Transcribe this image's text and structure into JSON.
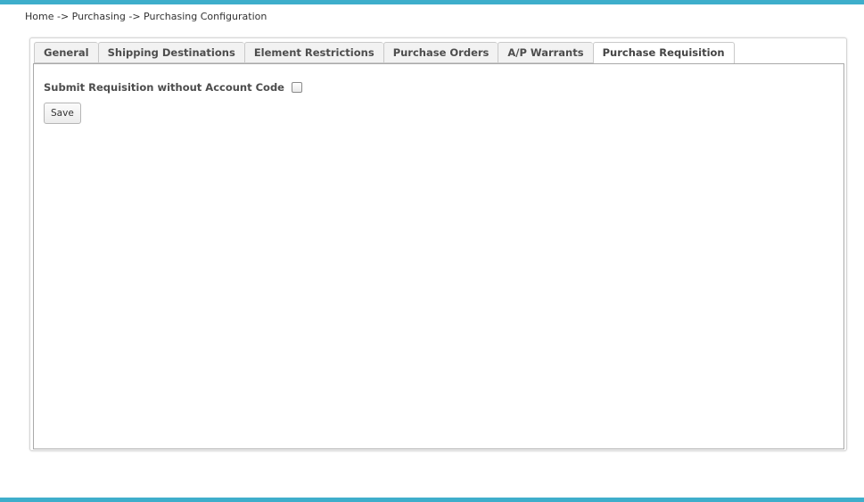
{
  "breadcrumb": {
    "text": "Home -> Purchasing -> Purchasing Configuration"
  },
  "tabs": [
    {
      "label": "General",
      "active": false
    },
    {
      "label": "Shipping Destinations",
      "active": false
    },
    {
      "label": "Element Restrictions",
      "active": false
    },
    {
      "label": "Purchase Orders",
      "active": false
    },
    {
      "label": "A/P Warrants",
      "active": false
    },
    {
      "label": "Purchase Requisition",
      "active": true
    }
  ],
  "form": {
    "submit_without_account_label": "Submit Requisition without Account Code",
    "submit_without_account_checked": false,
    "save_label": "Save"
  },
  "colors": {
    "accent_bar": "#3eaecb"
  }
}
